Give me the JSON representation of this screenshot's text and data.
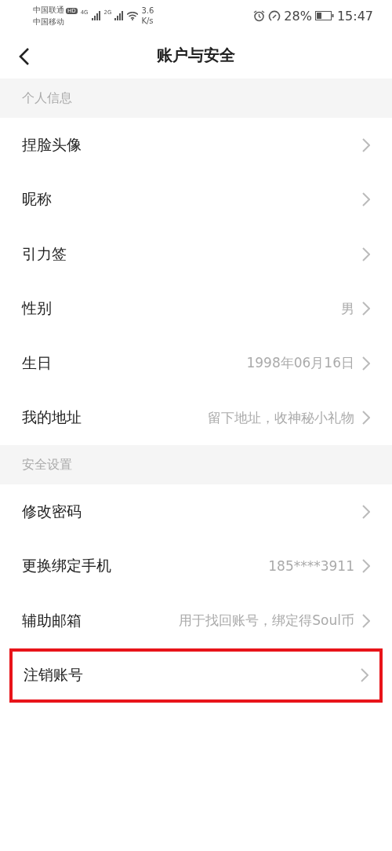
{
  "status_bar": {
    "carriers": [
      "中国联通",
      "中国移动"
    ],
    "hd_badge": "HD",
    "networks": [
      "4G",
      "2G"
    ],
    "speed": [
      "3.6",
      "K/s"
    ],
    "battery_percent": "28%",
    "time": "15:47"
  },
  "nav": {
    "title": "账户与安全"
  },
  "sections": [
    {
      "title": "个人信息",
      "rows": [
        {
          "label": "捏脸头像",
          "highlighted": false
        },
        {
          "label": "昵称",
          "highlighted": false
        },
        {
          "label": "引力签",
          "highlighted": false
        },
        {
          "label": "性别",
          "value": "男",
          "highlighted": false
        },
        {
          "label": "生日",
          "value": "1998年06月16日",
          "highlighted": false
        },
        {
          "label": "我的地址",
          "value": "留下地址，收神秘小礼物",
          "highlighted": false
        }
      ]
    },
    {
      "title": "安全设置",
      "rows": [
        {
          "label": "修改密码",
          "highlighted": false
        },
        {
          "label": "更换绑定手机",
          "value": "185****3911",
          "highlighted": false
        },
        {
          "label": "辅助邮箱",
          "value": "用于找回账号，绑定得Soul币",
          "highlighted": false
        },
        {
          "label": "注销账号",
          "highlighted": true
        }
      ]
    }
  ]
}
